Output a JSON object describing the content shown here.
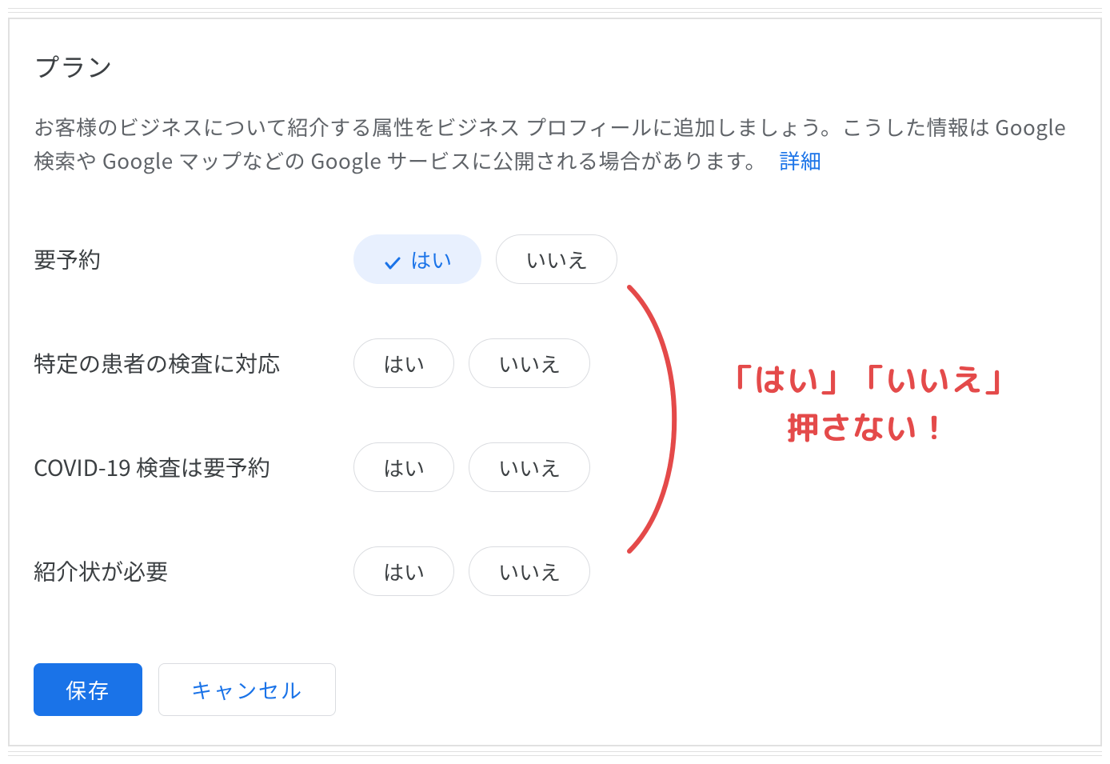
{
  "section": {
    "title": "プラン",
    "description_part1": "お客様のビジネスについて紹介する属性をビジネス プロフィールに追加しましょう。こうした情報は Google 検索や Google マップなどの Google サービスに公開される場合があります。",
    "details_link_label": "詳細"
  },
  "options": {
    "yes": "はい",
    "no": "いいえ"
  },
  "rows": [
    {
      "label": "要予約",
      "yes_selected": true
    },
    {
      "label": "特定の患者の検査に対応",
      "yes_selected": false
    },
    {
      "label": "COVID-19 検査は要予約",
      "yes_selected": false
    },
    {
      "label": "紹介状が必要",
      "yes_selected": false
    }
  ],
  "buttons": {
    "save": "保存",
    "cancel": "キャンセル"
  },
  "annotation": {
    "line1": "「はい」「いいえ」",
    "line2": "押さない！",
    "color": "#e44a4a"
  }
}
